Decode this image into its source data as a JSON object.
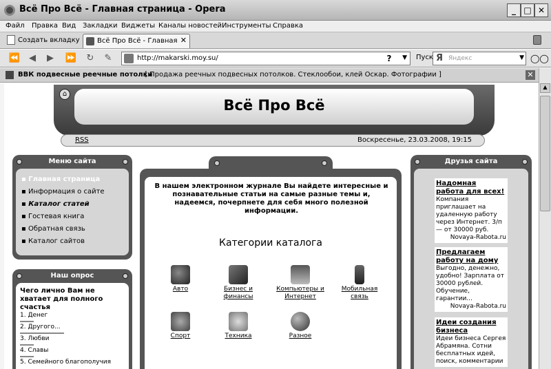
{
  "window": {
    "title": "Всё Про Всё - Главная страница - Opera"
  },
  "menu": [
    "Файл",
    "Правка",
    "Вид",
    "Закладки",
    "Виджеты",
    "Каналы новостей",
    "Инструменты",
    "Справка"
  ],
  "tabs": {
    "new_tab": "Создать вкладку",
    "active_tab": "Всё Про Всё - Главная с..."
  },
  "address": {
    "url": "http://makarski.moy.su/",
    "go_label": "Пуск",
    "search_placeholder": "Яндекс",
    "search_logo": "Я"
  },
  "infobar": {
    "title": "ВВК подвесные реечные потолки",
    "description": "[ Продажа реечных подвесных потолков. Стеклообои, клей Оскар. Фотографии ]"
  },
  "site": {
    "title": "Всё Про Всё",
    "rss": "RSS",
    "datetime": "Воскресенье, 23.03.2008, 19:15",
    "menu_title": "Меню сайта",
    "menu_items": [
      "Главная страница",
      "Информация о сайте",
      "Каталог статей",
      "Гостевая книга",
      "Обратная связь",
      "Каталог сайтов"
    ],
    "poll_title": "Наш опрос",
    "poll_question": "Чего лично Вам не хватает для полного счастья",
    "poll_options": [
      "1. Денег",
      "2. Другого...",
      "3. Любви",
      "4. Славы",
      "5. Семейного благополучия"
    ],
    "intro": "В нашем электронном журнале Вы найдете интересные и познавательные статьи на самые разные темы и, надеемся, почерпнете для себя много полезной информации.",
    "catalog_title": "Категории каталога",
    "categories": [
      {
        "label": "Авто",
        "icon": "car-icon"
      },
      {
        "label": "Бизнес и финансы",
        "icon": "handshake-icon"
      },
      {
        "label": "Компьютеры и Интернет",
        "icon": "computer-icon"
      },
      {
        "label": "Мобильная связь",
        "icon": "mobile-phone-icon"
      },
      {
        "label": "Спорт",
        "icon": "trophy-icon"
      },
      {
        "label": "Техника",
        "icon": "gadget-icon"
      },
      {
        "label": "Разное",
        "icon": "globe-icon"
      }
    ],
    "friends_title": "Друзья сайта",
    "ads": [
      {
        "title": "Надомная работа для всех!",
        "body": "Компания приглашает на удаленную работу через Интернет. 3/п — от 30000 руб.",
        "source": "Novaya-Rabota.ru"
      },
      {
        "title": "Предлагаем работу на дому",
        "body": "Выгодно, денежно, удобно! Зарплата от 30000 рублей. Обучение, гарантии...",
        "source": "Novaya-Rabota.ru"
      },
      {
        "title": "Идеи создания бизнеса",
        "body": "Идеи бизнеса Сергея Абрамяна. Сотни бесплатных идей, поиск, комментарии",
        "source": ""
      }
    ]
  }
}
